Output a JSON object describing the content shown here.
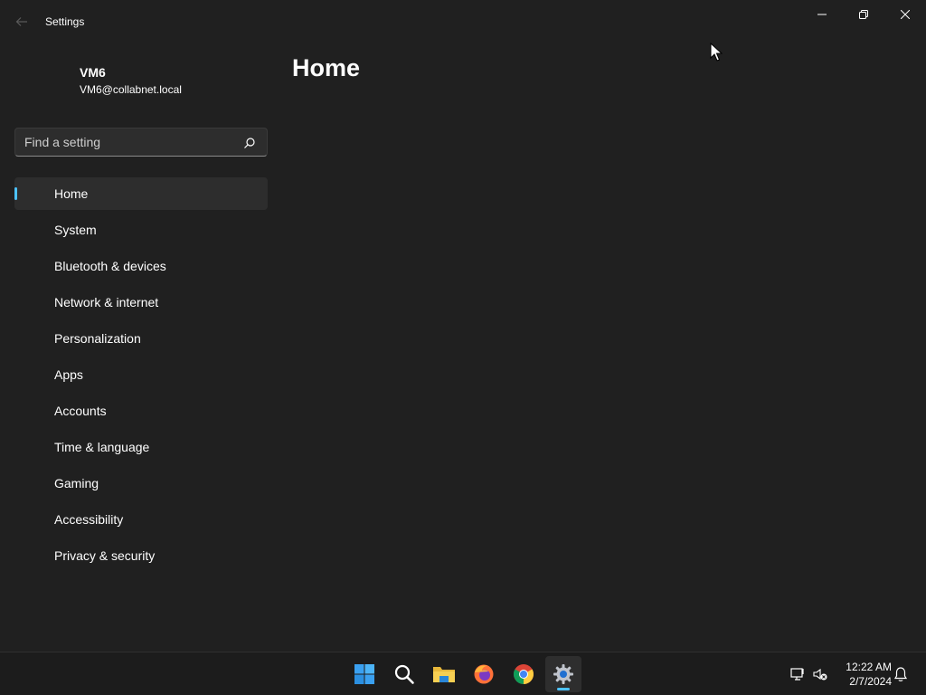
{
  "window": {
    "title": "Settings",
    "minimize_icon": "minimize-icon",
    "maximize_icon": "restore-icon",
    "close_icon": "close-icon"
  },
  "profile": {
    "name": "VM6",
    "email": "VM6@collabnet.local"
  },
  "search": {
    "placeholder": "Find a setting",
    "value": "",
    "icon": "search-icon"
  },
  "sidebar": {
    "items": [
      {
        "label": "Home",
        "active": true
      },
      {
        "label": "System"
      },
      {
        "label": "Bluetooth & devices"
      },
      {
        "label": "Network & internet"
      },
      {
        "label": "Personalization"
      },
      {
        "label": "Apps"
      },
      {
        "label": "Accounts"
      },
      {
        "label": "Time & language"
      },
      {
        "label": "Gaming"
      },
      {
        "label": "Accessibility"
      },
      {
        "label": "Privacy & security"
      }
    ]
  },
  "main": {
    "title": "Home"
  },
  "taskbar": {
    "apps": [
      "start-icon",
      "search-icon",
      "file-explorer-icon",
      "firefox-icon",
      "chrome-icon",
      "settings-icon"
    ],
    "clock_time": "12:22 AM",
    "clock_date": "2/7/2024"
  },
  "colors": {
    "accent": "#4cc2ff",
    "background": "#202020",
    "taskbar": "#1c1c1c"
  }
}
